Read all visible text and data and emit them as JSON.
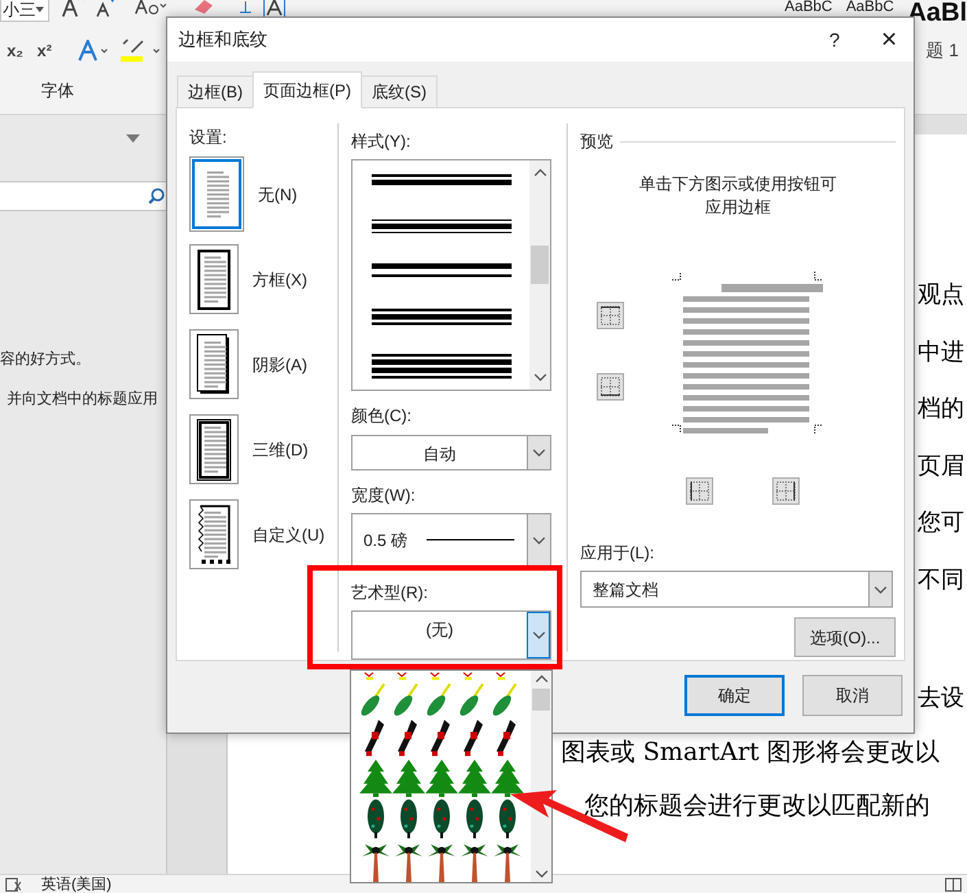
{
  "ribbon": {
    "font_size": "小三",
    "script_buttons": [
      "x₂",
      "x²"
    ],
    "style_samples": [
      "AaBbC",
      "AaBbC",
      "AaBl"
    ],
    "style_name": "题 1",
    "group_label": "字体"
  },
  "nav_pane": {
    "lines": [
      "容的好方式。",
      "并向文档中的标题应用"
    ]
  },
  "document": {
    "fragments": [
      "观点",
      "中进",
      "档的",
      "页眉",
      "您可",
      "不同",
      "去设"
    ],
    "lines": [
      "图表或 SmartArt 图形将会更改以",
      "您的标题会进行更改以匹配新的"
    ]
  },
  "status_bar": {
    "language": "英语(美国)"
  },
  "dialog": {
    "title": "边框和底纹",
    "help": "?",
    "close": "×",
    "tabs": [
      {
        "label": "边框(B)",
        "selected": false
      },
      {
        "label": "页面边框(P)",
        "selected": true
      },
      {
        "label": "底纹(S)",
        "selected": false
      }
    ],
    "settings": {
      "label": "设置:",
      "items": [
        {
          "label": "无(N)",
          "kind": "none",
          "selected": true
        },
        {
          "label": "方框(X)",
          "kind": "box",
          "selected": false
        },
        {
          "label": "阴影(A)",
          "kind": "shadow",
          "selected": false
        },
        {
          "label": "三维(D)",
          "kind": "double",
          "selected": false
        },
        {
          "label": "自定义(U)",
          "kind": "custom",
          "selected": false
        }
      ]
    },
    "style": {
      "label": "样式(Y):"
    },
    "color": {
      "label": "颜色(C):",
      "value": "自动"
    },
    "width": {
      "label": "宽度(W):",
      "value": "0.5 磅"
    },
    "art": {
      "label": "艺术型(R):",
      "value": "(无)",
      "expanded": true,
      "options": [
        {
          "kind": "pencil-tips"
        },
        {
          "kind": "feather"
        },
        {
          "kind": "bird"
        },
        {
          "kind": "pine"
        },
        {
          "kind": "fir"
        },
        {
          "kind": "palm"
        }
      ]
    },
    "preview": {
      "label": "预览",
      "hint": "单击下方图示或使用按钮可应用边框"
    },
    "apply_to": {
      "label": "应用于(L):",
      "value": "整篇文档"
    },
    "options_button": "选项(O)...",
    "buttons": [
      {
        "label": "确定",
        "default": true
      },
      {
        "label": "取消",
        "default": false
      }
    ]
  }
}
